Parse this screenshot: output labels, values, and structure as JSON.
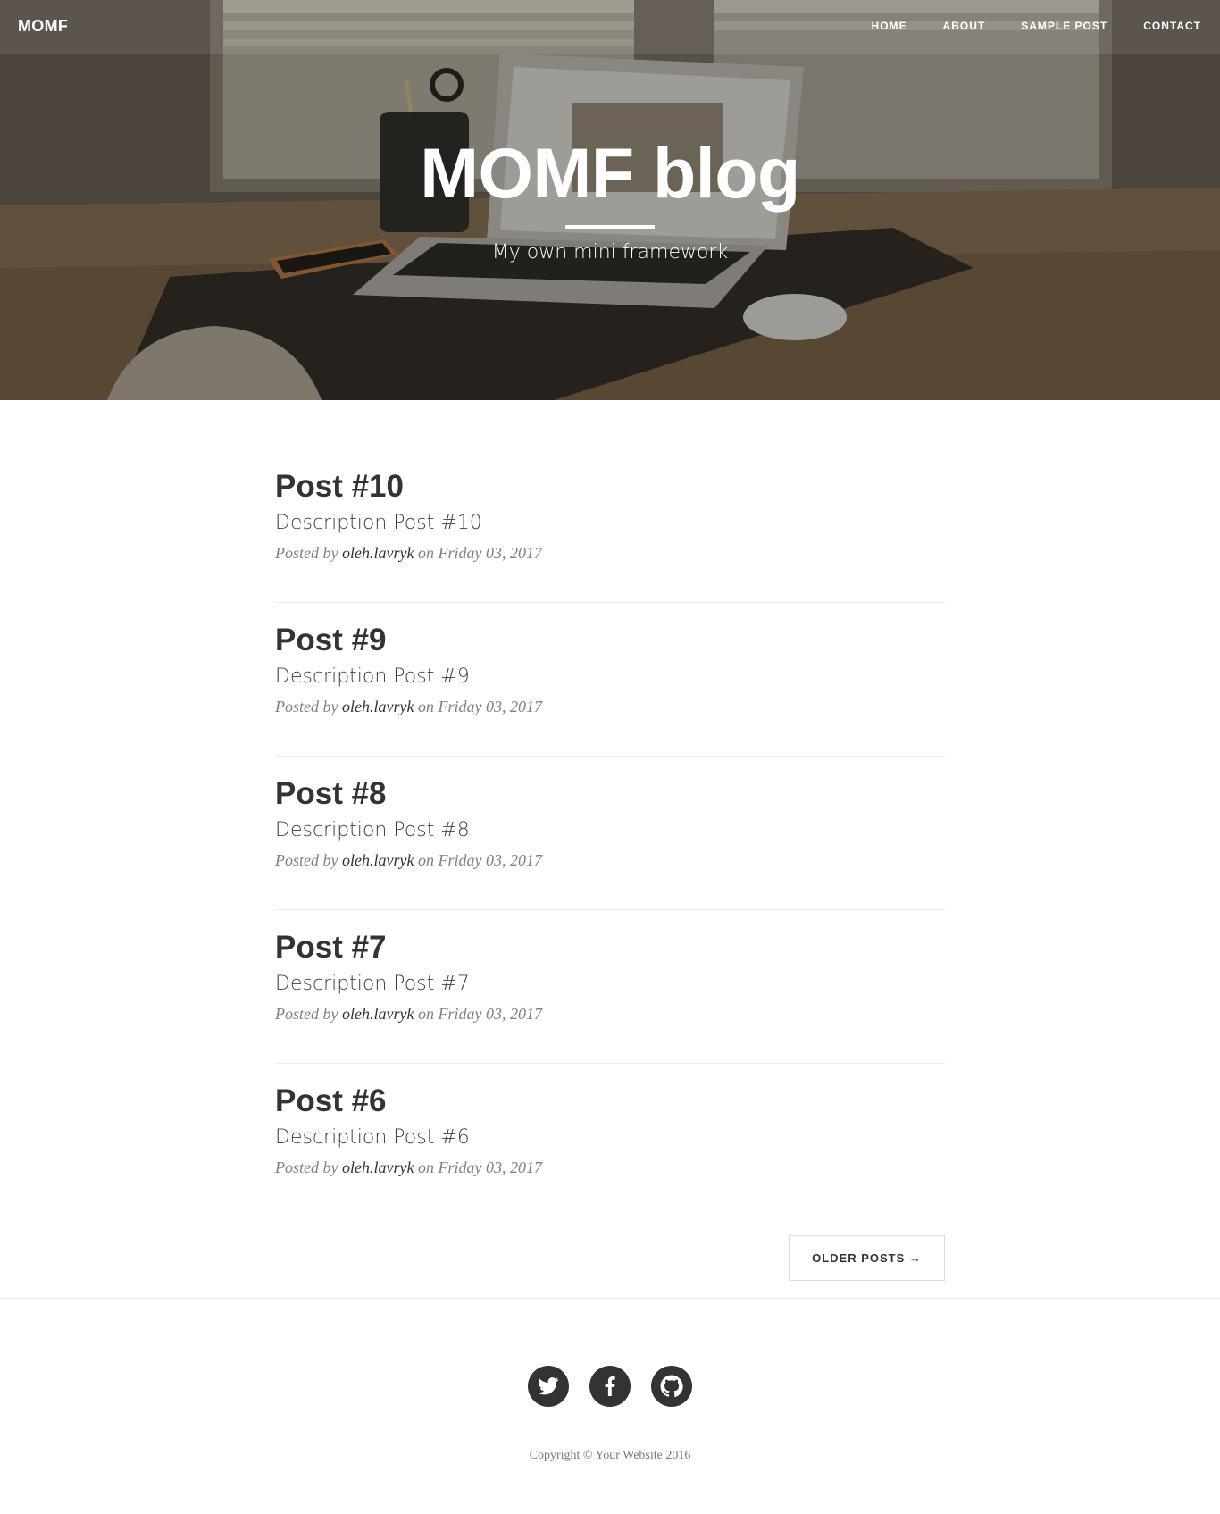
{
  "brand": "MOMF",
  "nav": [
    {
      "label": "Home"
    },
    {
      "label": "About"
    },
    {
      "label": "Sample Post"
    },
    {
      "label": "Contact"
    }
  ],
  "hero": {
    "title": "MOMF blog",
    "subtitle": "My own mini framework"
  },
  "posts": [
    {
      "title": "Post #10",
      "description": "Description Post #10",
      "posted_by": "Posted by",
      "author": "oleh.lavryk",
      "on": "on",
      "date": "Friday 03, 2017"
    },
    {
      "title": "Post #9",
      "description": "Description Post #9",
      "posted_by": "Posted by",
      "author": "oleh.lavryk",
      "on": "on",
      "date": "Friday 03, 2017"
    },
    {
      "title": "Post #8",
      "description": "Description Post #8",
      "posted_by": "Posted by",
      "author": "oleh.lavryk",
      "on": "on",
      "date": "Friday 03, 2017"
    },
    {
      "title": "Post #7",
      "description": "Description Post #7",
      "posted_by": "Posted by",
      "author": "oleh.lavryk",
      "on": "on",
      "date": "Friday 03, 2017"
    },
    {
      "title": "Post #6",
      "description": "Description Post #6",
      "posted_by": "Posted by",
      "author": "oleh.lavryk",
      "on": "on",
      "date": "Friday 03, 2017"
    }
  ],
  "pager": {
    "older_label": "Older Posts →"
  },
  "footer": {
    "social": [
      {
        "icon": "twitter-icon"
      },
      {
        "icon": "facebook-icon"
      },
      {
        "icon": "github-icon"
      }
    ],
    "copyright": "Copyright © Your Website 2016"
  },
  "colors": {
    "text": "#333333",
    "meta": "#808080",
    "divider": "#eeeeee",
    "social_bg": "#333333"
  }
}
